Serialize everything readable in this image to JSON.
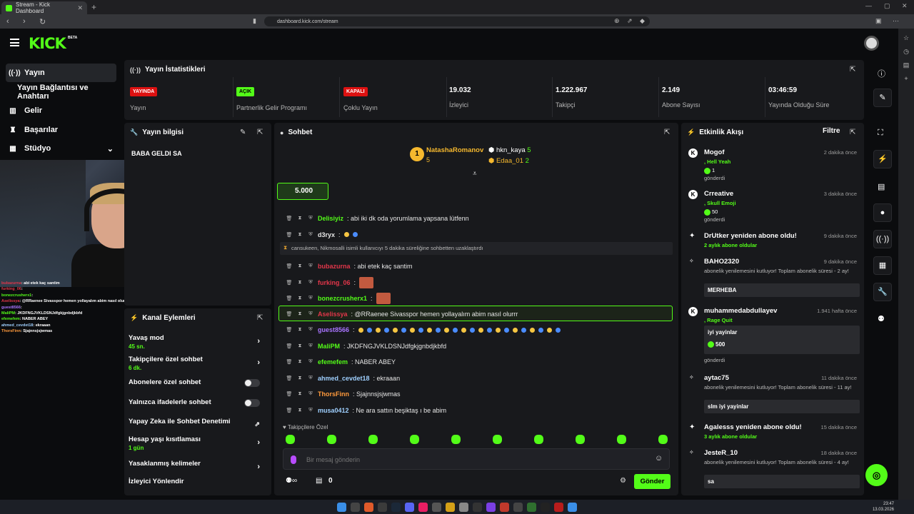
{
  "browser": {
    "tab_title": "Stream - Kick Dashboard",
    "url": "dashboard.kick.com/stream"
  },
  "brand": {
    "logo": "KICK",
    "beta": "BETA",
    "accent": "#53fc18"
  },
  "nav": {
    "items": [
      {
        "label": "Yayın",
        "icon": "broadcast-icon"
      },
      {
        "label": "Yayın Bağlantısı ve Anahtarı"
      },
      {
        "label": "Gelir",
        "icon": "revenue-icon"
      },
      {
        "label": "Başarılar",
        "icon": "trophy-icon"
      },
      {
        "label": "Stüdyo",
        "icon": "studio-icon"
      }
    ]
  },
  "overlay_chat": [
    {
      "user": "bubazurna",
      "text": ": abi etek kaç santim",
      "color": "#e2364a"
    },
    {
      "user": "furking_06",
      "text": ":",
      "color": "#e2364a"
    },
    {
      "user": "bonezcrusherx1",
      "text": ":",
      "color": "#53fc18"
    },
    {
      "user": "Aselissya",
      "text": ": @RRaenee Sivasspor hemen yollayalım abim nasıl olurrr",
      "color": "#e2364a"
    },
    {
      "user": "guest8566",
      "text": ":",
      "color": "#a974ff"
    },
    {
      "user": "MaliPM",
      "text": ": JKDFNGJVKLDSNJdfgkjgnbdjkbfd",
      "color": "#53fc18"
    },
    {
      "user": "efemefem",
      "text": ": NABER ABEY",
      "color": "#53fc18"
    },
    {
      "user": "ahmed_cevdet18",
      "text": ": ekraaan",
      "color": "#9fd0ff"
    },
    {
      "user": "ThorsFinn",
      "text": ": Sjajnnsjsjwmas",
      "color": "#ff9a3c"
    }
  ],
  "stats": {
    "title": "Yayın İstatistikleri",
    "items": [
      {
        "badge": "YAYINDA",
        "badge_type": "red",
        "label": "Yayın"
      },
      {
        "badge": "AÇIK",
        "badge_type": "green",
        "label": "Partnerlik Gelir Programı"
      },
      {
        "badge": "KAPALI",
        "badge_type": "red",
        "label": "Çoklu Yayın"
      },
      {
        "value": "19.032",
        "label": "İzleyici"
      },
      {
        "value": "1.222.967",
        "label": "Takipçi"
      },
      {
        "value": "2.149",
        "label": "Abone Sayısı"
      },
      {
        "value": "03:46:59",
        "label": "Yayında Olduğu Süre"
      }
    ]
  },
  "info": {
    "title": "Yayın bilgisi",
    "stream_title": "BABA GELDI SA"
  },
  "actions": {
    "title": "Kanal Eylemleri",
    "items": [
      {
        "label": "Yavaş mod",
        "sub": "45 sn.",
        "control": "chevron"
      },
      {
        "label": "Takipçilere özel sohbet",
        "sub": "6 dk.",
        "control": "chevron"
      },
      {
        "label": "Abonelere özel sohbet",
        "control": "toggle"
      },
      {
        "label": "Yalnızca ifadelerle sohbet",
        "control": "toggle"
      },
      {
        "label": "Yapay Zeka ile Sohbet Denetimi",
        "control": "external"
      },
      {
        "label": "Hesap yaşı kısıtlaması",
        "sub": "1 gün",
        "control": "chevron"
      },
      {
        "label": "Yasaklanmış kelimeler",
        "control": "chevron"
      },
      {
        "label": "İzleyici Yönlendir",
        "control": "none"
      }
    ]
  },
  "chat": {
    "title": "Sohbet",
    "leaderboard": [
      {
        "rank": "1",
        "name": "NatashaRomanov",
        "count": "5"
      },
      {
        "name": "hkn_kaya",
        "count": "5"
      },
      {
        "name": "Edaa_01",
        "count": "2"
      }
    ],
    "goal_value": "5.000",
    "messages": [
      {
        "user": "Delisiyiz",
        "text": ": abi iki dk oda yorumlama yapsana lütfenn",
        "color": "#53fc18"
      },
      {
        "user": "d3ryx",
        "text": ":",
        "color": "#e6e6e6",
        "emotes": [
          "#f5c542",
          "#4a8cff"
        ]
      },
      {
        "system": "cansukeen, Nikmosalli isimli kullanıcıyı 5 dakika süreliğine sohbetten uzaklaştırdı"
      },
      {
        "user": "bubazurna",
        "text": ": abi etek kaç santim",
        "color": "#e2364a"
      },
      {
        "user": "furking_06",
        "text": ":",
        "color": "#e2364a",
        "sticker": true
      },
      {
        "user": "bonezcrusherx1",
        "text": ":",
        "color": "#53fc18",
        "sticker": true
      },
      {
        "user": "Aselissya",
        "text": ": @RRaenee Sivasspor hemen yollayalım abim nasıl olurrr",
        "color": "#e2364a",
        "highlight": true
      },
      {
        "user": "guest8566",
        "text": ":",
        "color": "#a974ff",
        "hearts": true
      },
      {
        "user": "MaliPM",
        "text": ": JKDFNGJVKLDSNJdfgkjgnbdjkbfd",
        "color": "#53fc18"
      },
      {
        "user": "efemefem",
        "text": ": NABER ABEY",
        "color": "#53fc18"
      },
      {
        "user": "ahmed_cevdet18",
        "text": ": ekraaan",
        "color": "#9fd0ff"
      },
      {
        "user": "ThorsFinn",
        "text": ": Sjajnnsjsjwmas",
        "color": "#ff9a3c"
      },
      {
        "user": "musa0412",
        "text": ": Ne ara sattın beşiktaş ı be abim",
        "color": "#9fd0ff"
      }
    ],
    "followers_only": "Takipçilere Özel",
    "placeholder": "Bir mesaj gönderin",
    "count": "0",
    "send": "Gönder"
  },
  "activity": {
    "title": "Etkinlik Akışı",
    "filter": "Filtre",
    "events": [
      {
        "name": "Mogof",
        "time": "2 dakika önce",
        "line": ", Hell Yeah",
        "amount": "1",
        "foot": "gönderdi"
      },
      {
        "name": "Crreative",
        "time": "3 dakika önce",
        "line": ", Skull Emoji",
        "amount": "50",
        "foot": "gönderdi"
      },
      {
        "name": "DrUtker yeniden abone oldu!",
        "time": "9 dakika önce",
        "line": "2 aylık abone oldular"
      },
      {
        "name": "BAHO2320",
        "time": "9 dakika önce",
        "line": "abonelik yenilemesini kutluyor! Toplam abonelik süresi - 2 ay!",
        "box": "MERHEBA"
      },
      {
        "name": "muhammedabdullayev",
        "time": "1.941 hafta önce",
        "line": ", Rage Quit",
        "box": "iyi yayinlar",
        "amount": "500",
        "foot": "gönderdi"
      },
      {
        "name": "aytac75",
        "time": "11 dakika önce",
        "line": "abonelik yenilemesini kutluyor! Toplam abonelik süresi - 11 ay!",
        "box": "slm iyi yayinlar"
      },
      {
        "name": "Agalesss yeniden abone oldu!",
        "time": "15 dakika önce",
        "line": "3 aylık abone oldular"
      },
      {
        "name": "JesteR_10",
        "time": "18 dakika önce",
        "line": "abonelik yenilemesini kutluyor! Toplam abonelik süresi - 4 ay!",
        "box": "sa"
      }
    ]
  },
  "clock": {
    "time": "23:47",
    "date": "13.03.2026"
  }
}
